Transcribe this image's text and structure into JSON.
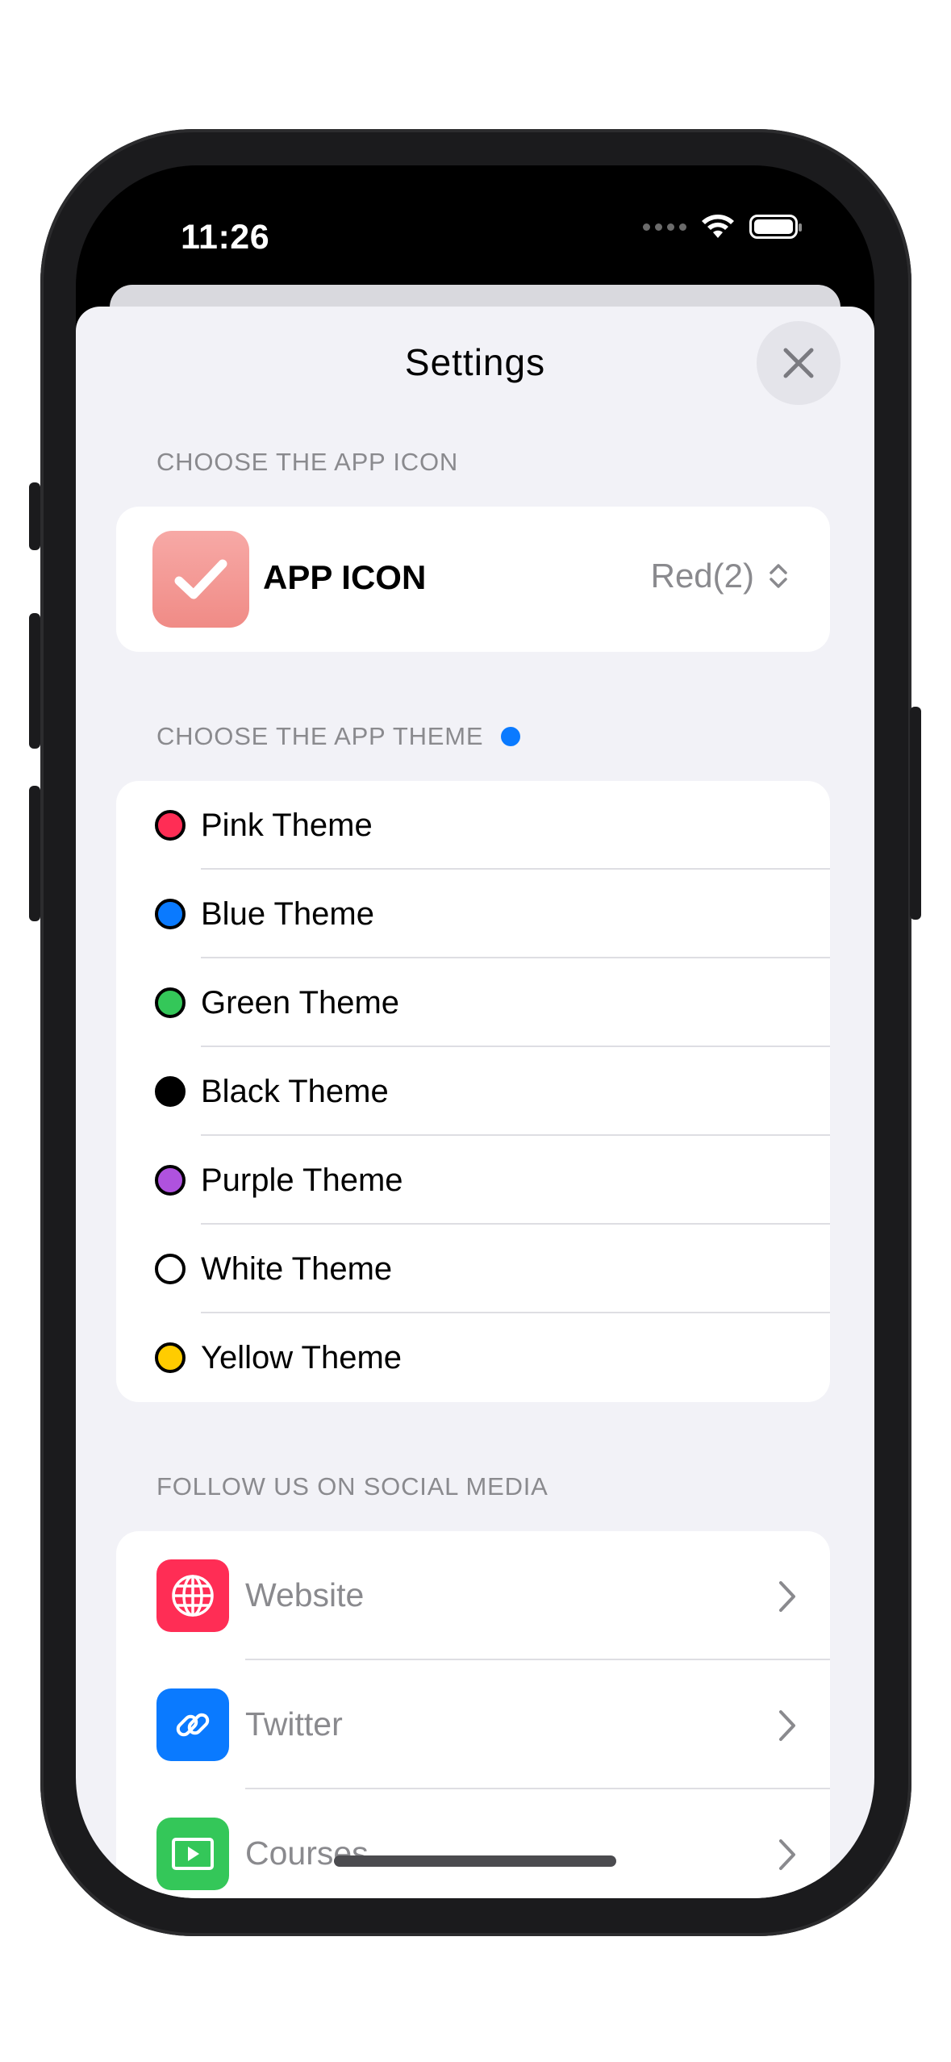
{
  "status_bar": {
    "time": "11:26"
  },
  "sheet": {
    "title": "Settings",
    "close_icon": "close-icon"
  },
  "app_icon_section": {
    "header": "CHOOSE THE APP ICON",
    "label": "APP ICON",
    "value": "Red(2)",
    "icon_color": "#f29490"
  },
  "theme_section": {
    "header": "CHOOSE THE APP THEME",
    "indicator_color": "#0a7aff",
    "themes": [
      {
        "label": "Pink Theme",
        "color": "#ff2d55"
      },
      {
        "label": "Blue Theme",
        "color": "#0a7aff"
      },
      {
        "label": "Green Theme",
        "color": "#34c759"
      },
      {
        "label": "Black Theme",
        "color": "#000000"
      },
      {
        "label": "Purple Theme",
        "color": "#af52de"
      },
      {
        "label": "White Theme",
        "color": "#ffffff"
      },
      {
        "label": "Yellow Theme",
        "color": "#ffcc00"
      }
    ]
  },
  "social_section": {
    "header": "FOLLOW US ON SOCIAL MEDIA",
    "items": [
      {
        "label": "Website",
        "icon": "globe-icon",
        "color": "#ff2d55"
      },
      {
        "label": "Twitter",
        "icon": "link-icon",
        "color": "#0a7aff"
      },
      {
        "label": "Courses",
        "icon": "play-icon",
        "color": "#34c759"
      }
    ]
  }
}
